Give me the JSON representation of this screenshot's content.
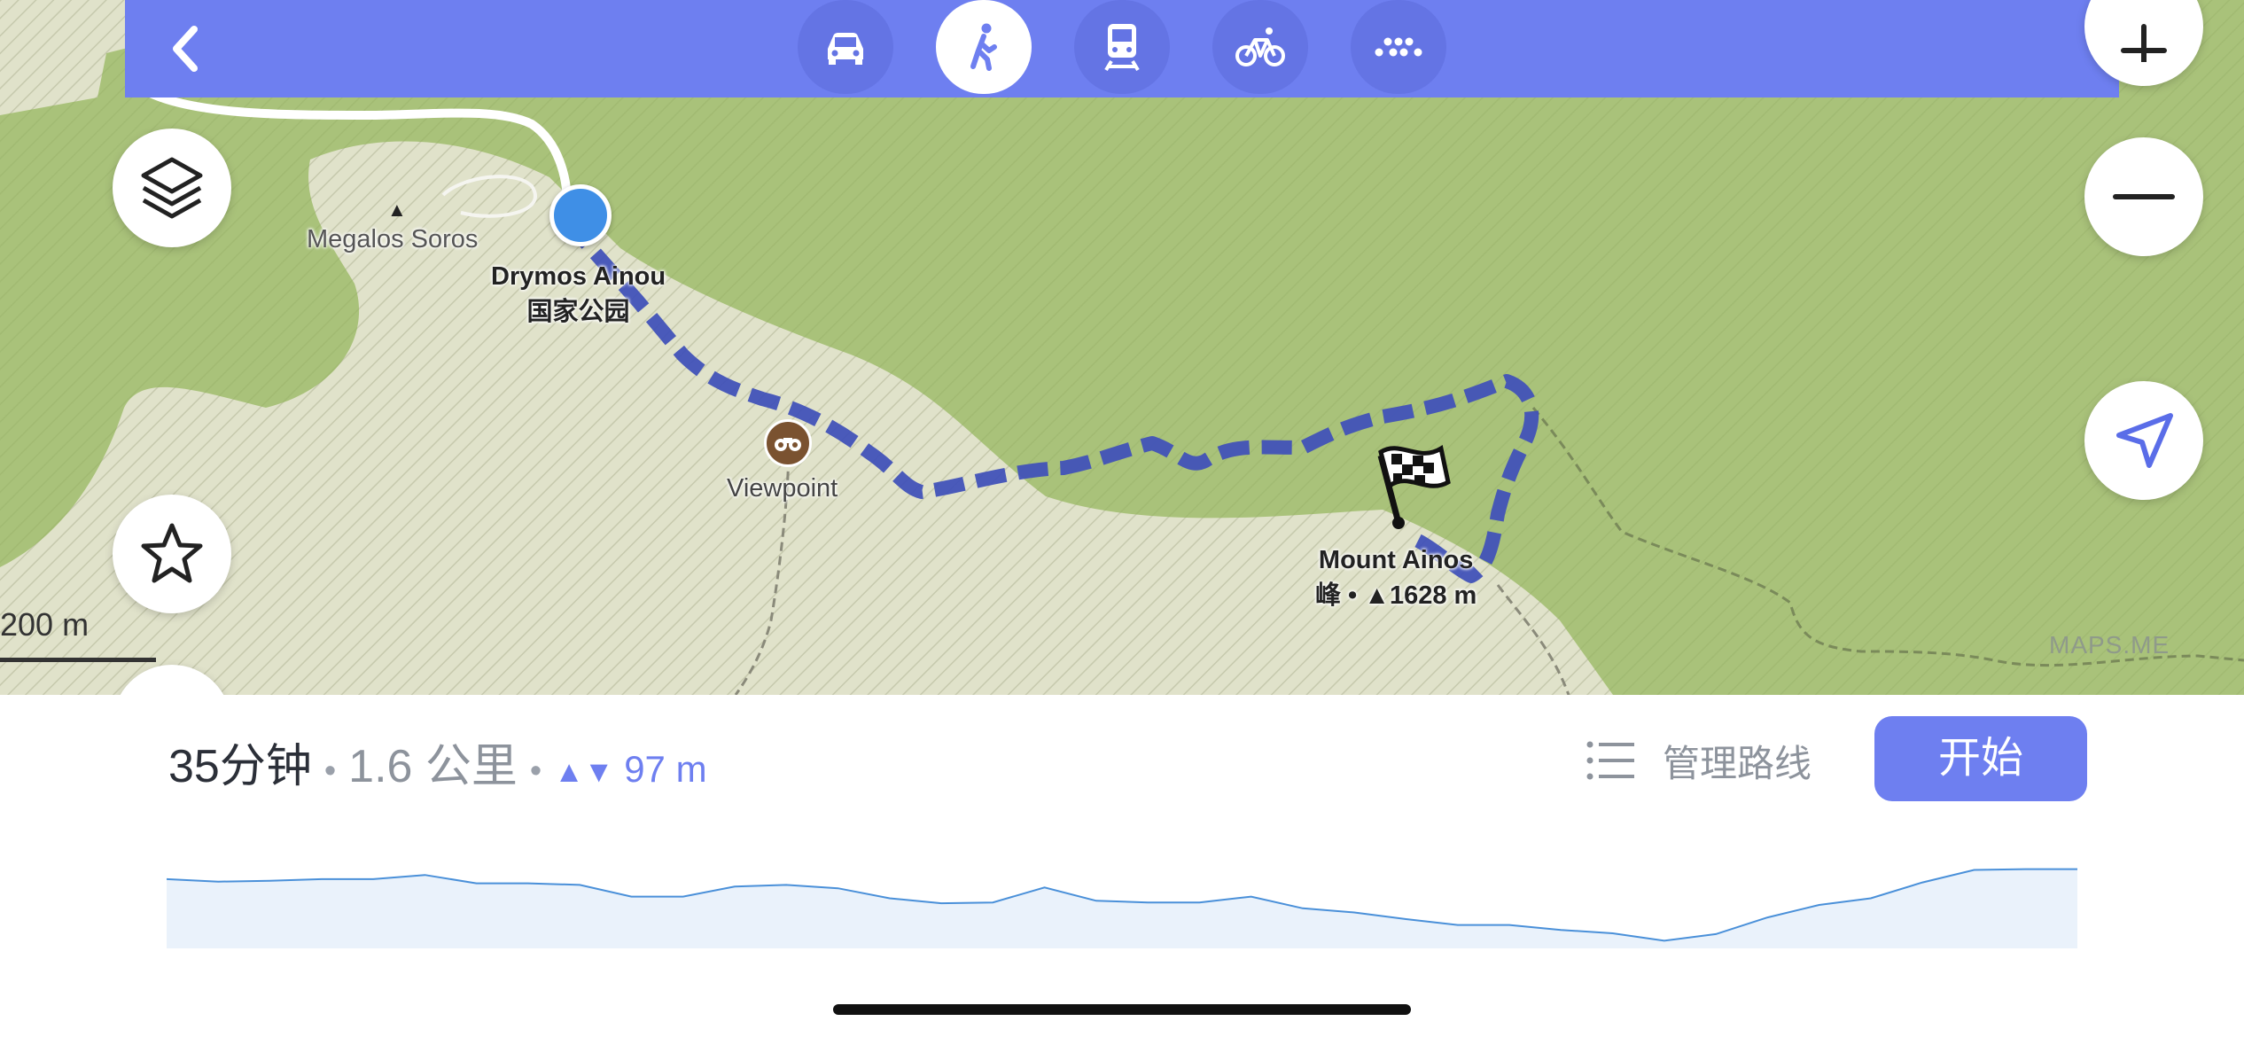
{
  "map": {
    "labels": {
      "megalos_soros": "Megalos Soros",
      "drymos_line1": "Drymos Ainou",
      "drymos_line2": "国家公园",
      "viewpoint": "Viewpoint",
      "ainos_line1": "Mount Ainos",
      "ainos_line2": "峰 • ▲1628 m"
    },
    "scale_label": "200 m",
    "watermark": "MAPS.ME",
    "colors": {
      "forest": "#a9c27a",
      "meadow": "#dfe1c7",
      "route": "#4152b8"
    }
  },
  "topbar": {
    "back_icon": "chevron-left-icon",
    "modes": [
      {
        "name": "car",
        "icon": "car-icon",
        "active": false
      },
      {
        "name": "pedestrian",
        "icon": "walking-icon",
        "active": true
      },
      {
        "name": "transit",
        "icon": "train-icon",
        "active": false
      },
      {
        "name": "bicycle",
        "icon": "bicycle-icon",
        "active": false
      },
      {
        "name": "taxi",
        "icon": "taxi-dots-icon",
        "active": false
      }
    ],
    "accent": "#6e7ff0"
  },
  "controls": {
    "layers_icon": "layers-icon",
    "bookmark_icon": "star-icon",
    "zoom_in_icon": "plus-icon",
    "zoom_out_icon": "minus-icon",
    "my_position_icon": "navigation-arrow-icon"
  },
  "route": {
    "time": "35分钟",
    "separator": "•",
    "distance": "1.6 公里",
    "elevation_icon": "▲▼",
    "elevation": "97 m",
    "manage_label": "管理路线",
    "manage_icon": "list-icon",
    "start_label": "开始"
  },
  "elevation_profile": {
    "type": "area",
    "relative_heights": [
      0.81,
      0.78,
      0.79,
      0.81,
      0.81,
      0.86,
      0.76,
      0.76,
      0.74,
      0.6,
      0.6,
      0.72,
      0.74,
      0.7,
      0.58,
      0.52,
      0.53,
      0.71,
      0.55,
      0.53,
      0.53,
      0.6,
      0.46,
      0.41,
      0.33,
      0.26,
      0.26,
      0.2,
      0.16,
      0.07,
      0.15,
      0.35,
      0.5,
      0.58,
      0.77,
      0.92,
      0.93,
      0.93
    ],
    "positions": [
      0.0,
      0.04,
      0.1,
      0.16,
      0.2,
      0.16,
      0.173,
      0.22,
      0.25,
      0.293,
      0.33,
      0.373,
      0.41,
      0.443,
      0.493,
      0.508,
      0.52,
      0.54,
      0.56,
      0.59,
      0.6,
      0.61,
      0.625,
      0.66,
      0.685,
      0.7,
      0.74,
      0.8,
      0.77,
      0.774,
      0.8,
      0.85,
      0.875,
      0.93,
      0.98,
      1.0,
      1.0,
      1.0
    ],
    "line_color": "#4a90d9",
    "fill_color": "#eaf2fb"
  }
}
